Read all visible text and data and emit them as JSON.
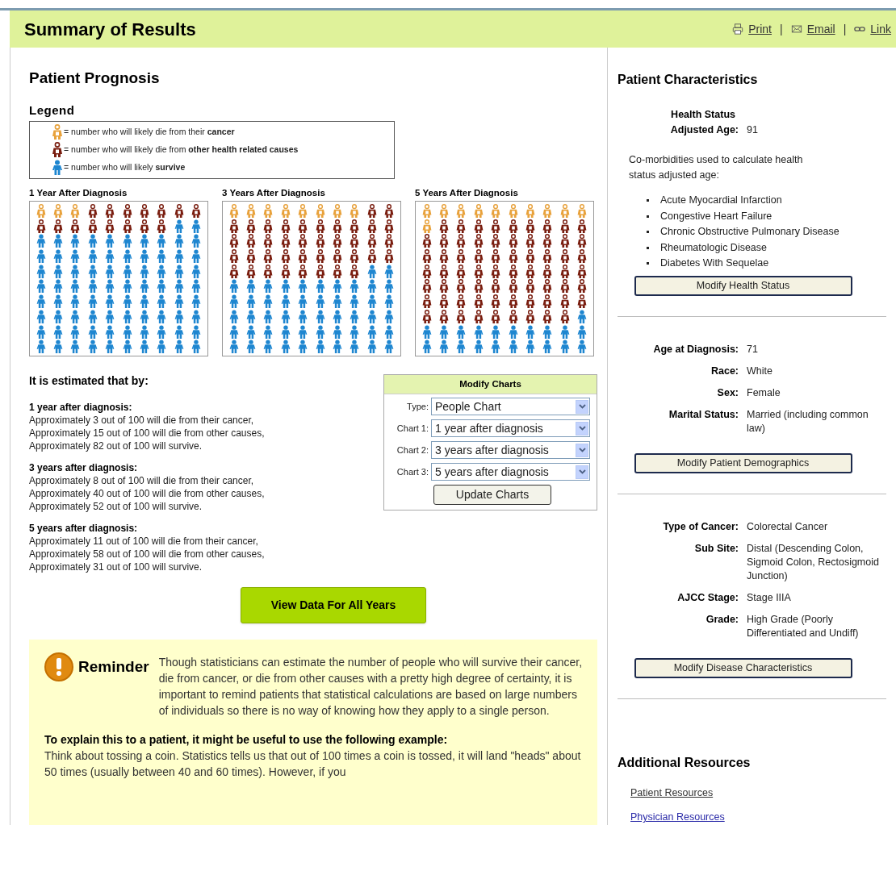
{
  "header": {
    "title": "Summary of Results",
    "links": [
      {
        "label": "Print",
        "kind": "print"
      },
      {
        "label": "Email",
        "kind": "email"
      },
      {
        "label": "Link",
        "kind": "link"
      }
    ],
    "separators": [
      "|",
      "|"
    ]
  },
  "prognosis": {
    "title": "Patient Prognosis",
    "legend_title": "Legend",
    "legend": [
      {
        "kind": "cancer",
        "text": "= number who will likely die from their **cancer**"
      },
      {
        "kind": "other",
        "text": "= number who will likely die from **other health related causes**"
      },
      {
        "kind": "survive",
        "text": "= number who will likely **survive**"
      }
    ],
    "charts": [
      {
        "title": "1 Year After Diagnosis",
        "rows": [
          {
            "people": [
              {
                "kind": "cancer"
              },
              {
                "kind": "cancer"
              },
              {
                "kind": "cancer"
              },
              {
                "kind": "other"
              },
              {
                "kind": "other"
              },
              {
                "kind": "other"
              },
              {
                "kind": "other"
              },
              {
                "kind": "other"
              },
              {
                "kind": "other"
              },
              {
                "kind": "other"
              }
            ]
          },
          {
            "people": [
              {
                "kind": "other"
              },
              {
                "kind": "other"
              },
              {
                "kind": "other"
              },
              {
                "kind": "other"
              },
              {
                "kind": "other"
              },
              {
                "kind": "other"
              },
              {
                "kind": "other"
              },
              {
                "kind": "other"
              },
              {
                "kind": "survive"
              },
              {
                "kind": "survive"
              }
            ]
          },
          {
            "people": [
              {
                "kind": "survive"
              },
              {
                "kind": "survive"
              },
              {
                "kind": "survive"
              },
              {
                "kind": "survive"
              },
              {
                "kind": "survive"
              },
              {
                "kind": "survive"
              },
              {
                "kind": "survive"
              },
              {
                "kind": "survive"
              },
              {
                "kind": "survive"
              },
              {
                "kind": "survive"
              }
            ]
          },
          {
            "people": [
              {
                "kind": "survive"
              },
              {
                "kind": "survive"
              },
              {
                "kind": "survive"
              },
              {
                "kind": "survive"
              },
              {
                "kind": "survive"
              },
              {
                "kind": "survive"
              },
              {
                "kind": "survive"
              },
              {
                "kind": "survive"
              },
              {
                "kind": "survive"
              },
              {
                "kind": "survive"
              }
            ]
          },
          {
            "people": [
              {
                "kind": "survive"
              },
              {
                "kind": "survive"
              },
              {
                "kind": "survive"
              },
              {
                "kind": "survive"
              },
              {
                "kind": "survive"
              },
              {
                "kind": "survive"
              },
              {
                "kind": "survive"
              },
              {
                "kind": "survive"
              },
              {
                "kind": "survive"
              },
              {
                "kind": "survive"
              }
            ]
          },
          {
            "people": [
              {
                "kind": "survive"
              },
              {
                "kind": "survive"
              },
              {
                "kind": "survive"
              },
              {
                "kind": "survive"
              },
              {
                "kind": "survive"
              },
              {
                "kind": "survive"
              },
              {
                "kind": "survive"
              },
              {
                "kind": "survive"
              },
              {
                "kind": "survive"
              },
              {
                "kind": "survive"
              }
            ]
          },
          {
            "people": [
              {
                "kind": "survive"
              },
              {
                "kind": "survive"
              },
              {
                "kind": "survive"
              },
              {
                "kind": "survive"
              },
              {
                "kind": "survive"
              },
              {
                "kind": "survive"
              },
              {
                "kind": "survive"
              },
              {
                "kind": "survive"
              },
              {
                "kind": "survive"
              },
              {
                "kind": "survive"
              }
            ]
          },
          {
            "people": [
              {
                "kind": "survive"
              },
              {
                "kind": "survive"
              },
              {
                "kind": "survive"
              },
              {
                "kind": "survive"
              },
              {
                "kind": "survive"
              },
              {
                "kind": "survive"
              },
              {
                "kind": "survive"
              },
              {
                "kind": "survive"
              },
              {
                "kind": "survive"
              },
              {
                "kind": "survive"
              }
            ]
          },
          {
            "people": [
              {
                "kind": "survive"
              },
              {
                "kind": "survive"
              },
              {
                "kind": "survive"
              },
              {
                "kind": "survive"
              },
              {
                "kind": "survive"
              },
              {
                "kind": "survive"
              },
              {
                "kind": "survive"
              },
              {
                "kind": "survive"
              },
              {
                "kind": "survive"
              },
              {
                "kind": "survive"
              }
            ]
          },
          {
            "people": [
              {
                "kind": "survive"
              },
              {
                "kind": "survive"
              },
              {
                "kind": "survive"
              },
              {
                "kind": "survive"
              },
              {
                "kind": "survive"
              },
              {
                "kind": "survive"
              },
              {
                "kind": "survive"
              },
              {
                "kind": "survive"
              },
              {
                "kind": "survive"
              },
              {
                "kind": "survive"
              }
            ]
          }
        ]
      },
      {
        "title": "3 Years After Diagnosis",
        "rows": [
          {
            "people": [
              {
                "kind": "cancer"
              },
              {
                "kind": "cancer"
              },
              {
                "kind": "cancer"
              },
              {
                "kind": "cancer"
              },
              {
                "kind": "cancer"
              },
              {
                "kind": "cancer"
              },
              {
                "kind": "cancer"
              },
              {
                "kind": "cancer"
              },
              {
                "kind": "other"
              },
              {
                "kind": "other"
              }
            ]
          },
          {
            "people": [
              {
                "kind": "other"
              },
              {
                "kind": "other"
              },
              {
                "kind": "other"
              },
              {
                "kind": "other"
              },
              {
                "kind": "other"
              },
              {
                "kind": "other"
              },
              {
                "kind": "other"
              },
              {
                "kind": "other"
              },
              {
                "kind": "other"
              },
              {
                "kind": "other"
              }
            ]
          },
          {
            "people": [
              {
                "kind": "other"
              },
              {
                "kind": "other"
              },
              {
                "kind": "other"
              },
              {
                "kind": "other"
              },
              {
                "kind": "other"
              },
              {
                "kind": "other"
              },
              {
                "kind": "other"
              },
              {
                "kind": "other"
              },
              {
                "kind": "other"
              },
              {
                "kind": "other"
              }
            ]
          },
          {
            "people": [
              {
                "kind": "other"
              },
              {
                "kind": "other"
              },
              {
                "kind": "other"
              },
              {
                "kind": "other"
              },
              {
                "kind": "other"
              },
              {
                "kind": "other"
              },
              {
                "kind": "other"
              },
              {
                "kind": "other"
              },
              {
                "kind": "other"
              },
              {
                "kind": "other"
              }
            ]
          },
          {
            "people": [
              {
                "kind": "other"
              },
              {
                "kind": "other"
              },
              {
                "kind": "other"
              },
              {
                "kind": "other"
              },
              {
                "kind": "other"
              },
              {
                "kind": "other"
              },
              {
                "kind": "other"
              },
              {
                "kind": "other"
              },
              {
                "kind": "survive"
              },
              {
                "kind": "survive"
              }
            ]
          },
          {
            "people": [
              {
                "kind": "survive"
              },
              {
                "kind": "survive"
              },
              {
                "kind": "survive"
              },
              {
                "kind": "survive"
              },
              {
                "kind": "survive"
              },
              {
                "kind": "survive"
              },
              {
                "kind": "survive"
              },
              {
                "kind": "survive"
              },
              {
                "kind": "survive"
              },
              {
                "kind": "survive"
              }
            ]
          },
          {
            "people": [
              {
                "kind": "survive"
              },
              {
                "kind": "survive"
              },
              {
                "kind": "survive"
              },
              {
                "kind": "survive"
              },
              {
                "kind": "survive"
              },
              {
                "kind": "survive"
              },
              {
                "kind": "survive"
              },
              {
                "kind": "survive"
              },
              {
                "kind": "survive"
              },
              {
                "kind": "survive"
              }
            ]
          },
          {
            "people": [
              {
                "kind": "survive"
              },
              {
                "kind": "survive"
              },
              {
                "kind": "survive"
              },
              {
                "kind": "survive"
              },
              {
                "kind": "survive"
              },
              {
                "kind": "survive"
              },
              {
                "kind": "survive"
              },
              {
                "kind": "survive"
              },
              {
                "kind": "survive"
              },
              {
                "kind": "survive"
              }
            ]
          },
          {
            "people": [
              {
                "kind": "survive"
              },
              {
                "kind": "survive"
              },
              {
                "kind": "survive"
              },
              {
                "kind": "survive"
              },
              {
                "kind": "survive"
              },
              {
                "kind": "survive"
              },
              {
                "kind": "survive"
              },
              {
                "kind": "survive"
              },
              {
                "kind": "survive"
              },
              {
                "kind": "survive"
              }
            ]
          },
          {
            "people": [
              {
                "kind": "survive"
              },
              {
                "kind": "survive"
              },
              {
                "kind": "survive"
              },
              {
                "kind": "survive"
              },
              {
                "kind": "survive"
              },
              {
                "kind": "survive"
              },
              {
                "kind": "survive"
              },
              {
                "kind": "survive"
              },
              {
                "kind": "survive"
              },
              {
                "kind": "survive"
              }
            ]
          }
        ]
      },
      {
        "title": "5 Years After Diagnosis",
        "rows": [
          {
            "people": [
              {
                "kind": "cancer"
              },
              {
                "kind": "cancer"
              },
              {
                "kind": "cancer"
              },
              {
                "kind": "cancer"
              },
              {
                "kind": "cancer"
              },
              {
                "kind": "cancer"
              },
              {
                "kind": "cancer"
              },
              {
                "kind": "cancer"
              },
              {
                "kind": "cancer"
              },
              {
                "kind": "cancer"
              }
            ]
          },
          {
            "people": [
              {
                "kind": "cancer"
              },
              {
                "kind": "other"
              },
              {
                "kind": "other"
              },
              {
                "kind": "other"
              },
              {
                "kind": "other"
              },
              {
                "kind": "other"
              },
              {
                "kind": "other"
              },
              {
                "kind": "other"
              },
              {
                "kind": "other"
              },
              {
                "kind": "other"
              }
            ]
          },
          {
            "people": [
              {
                "kind": "other"
              },
              {
                "kind": "other"
              },
              {
                "kind": "other"
              },
              {
                "kind": "other"
              },
              {
                "kind": "other"
              },
              {
                "kind": "other"
              },
              {
                "kind": "other"
              },
              {
                "kind": "other"
              },
              {
                "kind": "other"
              },
              {
                "kind": "other"
              }
            ]
          },
          {
            "people": [
              {
                "kind": "other"
              },
              {
                "kind": "other"
              },
              {
                "kind": "other"
              },
              {
                "kind": "other"
              },
              {
                "kind": "other"
              },
              {
                "kind": "other"
              },
              {
                "kind": "other"
              },
              {
                "kind": "other"
              },
              {
                "kind": "other"
              },
              {
                "kind": "other"
              }
            ]
          },
          {
            "people": [
              {
                "kind": "other"
              },
              {
                "kind": "other"
              },
              {
                "kind": "other"
              },
              {
                "kind": "other"
              },
              {
                "kind": "other"
              },
              {
                "kind": "other"
              },
              {
                "kind": "other"
              },
              {
                "kind": "other"
              },
              {
                "kind": "other"
              },
              {
                "kind": "other"
              }
            ]
          },
          {
            "people": [
              {
                "kind": "other"
              },
              {
                "kind": "other"
              },
              {
                "kind": "other"
              },
              {
                "kind": "other"
              },
              {
                "kind": "other"
              },
              {
                "kind": "other"
              },
              {
                "kind": "other"
              },
              {
                "kind": "other"
              },
              {
                "kind": "other"
              },
              {
                "kind": "other"
              }
            ]
          },
          {
            "people": [
              {
                "kind": "other"
              },
              {
                "kind": "other"
              },
              {
                "kind": "other"
              },
              {
                "kind": "other"
              },
              {
                "kind": "other"
              },
              {
                "kind": "other"
              },
              {
                "kind": "other"
              },
              {
                "kind": "other"
              },
              {
                "kind": "other"
              },
              {
                "kind": "other"
              }
            ]
          },
          {
            "people": [
              {
                "kind": "other"
              },
              {
                "kind": "other"
              },
              {
                "kind": "other"
              },
              {
                "kind": "other"
              },
              {
                "kind": "other"
              },
              {
                "kind": "other"
              },
              {
                "kind": "other"
              },
              {
                "kind": "other"
              },
              {
                "kind": "other"
              },
              {
                "kind": "survive"
              }
            ]
          },
          {
            "people": [
              {
                "kind": "survive"
              },
              {
                "kind": "survive"
              },
              {
                "kind": "survive"
              },
              {
                "kind": "survive"
              },
              {
                "kind": "survive"
              },
              {
                "kind": "survive"
              },
              {
                "kind": "survive"
              },
              {
                "kind": "survive"
              },
              {
                "kind": "survive"
              },
              {
                "kind": "survive"
              }
            ]
          },
          {
            "people": [
              {
                "kind": "survive"
              },
              {
                "kind": "survive"
              },
              {
                "kind": "survive"
              },
              {
                "kind": "survive"
              },
              {
                "kind": "survive"
              },
              {
                "kind": "survive"
              },
              {
                "kind": "survive"
              },
              {
                "kind": "survive"
              },
              {
                "kind": "survive"
              },
              {
                "kind": "survive"
              }
            ]
          }
        ]
      }
    ],
    "estimate_title": "It is estimated that by:",
    "estimates": [
      {
        "heading": "1 year after diagnosis:",
        "lines": [
          "Approximately 3 out of 100 will die from their cancer,",
          "Approximately 15 out of 100 will die from other causes,",
          "Approximately 82 out of 100 will survive."
        ]
      },
      {
        "heading": "3 years after diagnosis:",
        "lines": [
          "Approximately 8 out of 100 will die from their cancer,",
          "Approximately 40 out of 100 will die from other causes,",
          "Approximately 52 out of 100 will survive."
        ]
      },
      {
        "heading": "5 years after diagnosis:",
        "lines": [
          "Approximately 11 out of 100 will die from their cancer,",
          "Approximately 58 out of 100 will die from other causes,",
          "Approximately 31 out of 100 will survive."
        ]
      }
    ],
    "modify_charts": {
      "title": "Modify Charts",
      "fields": [
        {
          "label": "Type:",
          "value": "People Chart"
        },
        {
          "label": "Chart 1:",
          "value": "1 year after diagnosis"
        },
        {
          "label": "Chart 2:",
          "value": "3 years after diagnosis"
        },
        {
          "label": "Chart 3:",
          "value": "5 years after diagnosis"
        }
      ],
      "button": "Update Charts"
    },
    "view_all_button": "View Data For All Years",
    "reminder": {
      "title": "Reminder",
      "text": "Though statisticians can estimate the number of people who will survive their cancer, die from cancer, or die from other causes with a pretty high degree of certainty, it is important to remind patients that statistical calculations are based on large numbers of individuals so there is no way of knowing how they apply to a single person.",
      "example_title": "To explain this to a patient, it might be useful to use the following example:",
      "example_text": "Think about tossing a coin. Statistics tells us that out of 100 times a coin is tossed, it will land \"heads\" about 50 times (usually between 40 and 60 times). However, if you"
    }
  },
  "characteristics": {
    "title": "Patient Characteristics",
    "health": {
      "label_line1": "Health Status",
      "label_line2": "Adjusted Age:",
      "value": "91"
    },
    "comorbidities_intro": "Co-morbidities used to calculate health status adjusted age:",
    "comorbidities": [
      "Acute Myocardial Infarction",
      "Congestive Heart Failure",
      "Chronic Obstructive Pulmonary Disease",
      "Rheumatologic Disease",
      "Diabetes With Sequelae"
    ],
    "sections": [
      {
        "button": "Modify Health Status"
      },
      {
        "fields": [
          {
            "label": "Age at Diagnosis:",
            "value": "71"
          },
          {
            "label": "Race:",
            "value": "White"
          },
          {
            "label": "Sex:",
            "value": "Female"
          },
          {
            "label": "Marital Status:",
            "value": "Married (including common law)"
          }
        ],
        "button": "Modify Patient Demographics"
      },
      {
        "fields": [
          {
            "label": "Type of Cancer:",
            "value": "Colorectal Cancer"
          },
          {
            "label": "Sub Site:",
            "value": "Distal (Descending Colon, Sigmoid Colon, Rectosigmoid Junction)"
          },
          {
            "label": "AJCC Stage:",
            "value": "Stage IIIA"
          },
          {
            "label": "Grade:",
            "value": "High Grade (Poorly Differentiated and Undiff)"
          }
        ],
        "button": "Modify Disease Characteristics"
      }
    ]
  },
  "resources": {
    "title": "Additional Resources",
    "links": [
      {
        "label": "Patient Resources",
        "visited": true
      },
      {
        "label": "Physician Resources",
        "visited": false
      }
    ]
  }
}
